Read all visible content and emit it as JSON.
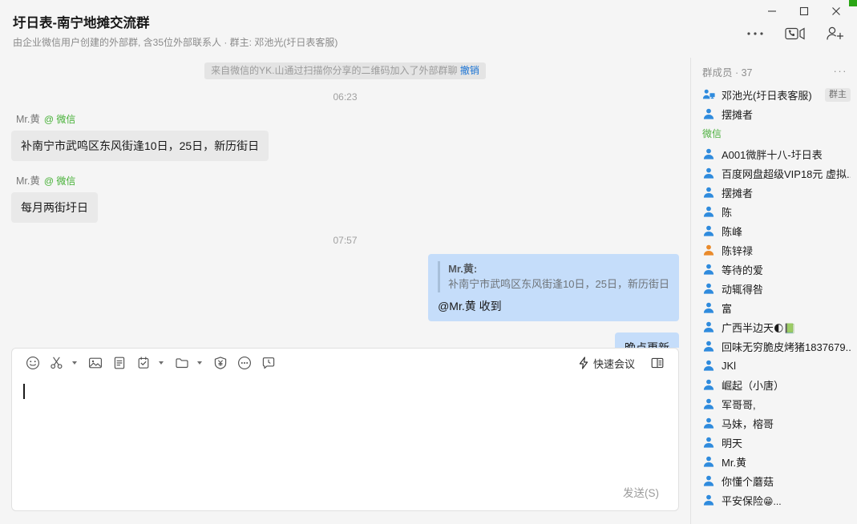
{
  "window": {
    "minimize_label": "Minimize",
    "maximize_label": "Maximize",
    "close_label": "Close"
  },
  "header": {
    "title": "圩日表-南宁地摊交流群",
    "subtitle": "由企业微信用户创建的外部群, 含35位外部联系人 · 群主: 邓池光(圩日表客服)",
    "actions": [
      {
        "name": "more-options-icon",
        "label": "更多"
      },
      {
        "name": "video-call-icon",
        "label": "视频通话"
      },
      {
        "name": "add-member-icon",
        "label": "添加成员"
      }
    ]
  },
  "chat": {
    "system_message": {
      "text": "来自微信的YK.山通过扫描你分享的二维码加入了外部群聊",
      "undo_label": "撤销"
    },
    "timestamps": {
      "first": "06:23",
      "second": "07:57"
    },
    "messages": [
      {
        "sender": "Mr.黄",
        "source_tag": "@ 微信",
        "text": "补南宁市武鸣区东风街逢10日，25日，新历街日",
        "side": "in"
      },
      {
        "sender": "Mr.黄",
        "source_tag": "@ 微信",
        "text": "每月两街圩日",
        "side": "in"
      },
      {
        "quote_name": "Mr.黄:",
        "quote_text": "补南宁市武鸣区东风街逢10日，25日，新历街日",
        "text": "@Mr.黄 收到",
        "side": "out"
      },
      {
        "text": "晚点更新",
        "side": "out"
      }
    ]
  },
  "composer": {
    "tools": [
      {
        "name": "emoji-icon",
        "label": "表情",
        "caret": false
      },
      {
        "name": "scissors-screenshot-icon",
        "label": "截图",
        "caret": true
      },
      {
        "name": "image-icon",
        "label": "图片",
        "caret": false
      },
      {
        "name": "document-icon",
        "label": "文档",
        "caret": false
      },
      {
        "name": "checklist-todo-icon",
        "label": "待办",
        "caret": true
      },
      {
        "name": "folder-icon",
        "label": "文件",
        "caret": true
      },
      {
        "name": "red-packet-icon",
        "label": "红包",
        "caret": false
      },
      {
        "name": "more-tools-icon",
        "label": "更多",
        "caret": false
      },
      {
        "name": "chat-history-icon",
        "label": "聊天记录",
        "caret": false
      }
    ],
    "quick_meeting_label": "快速会议",
    "panel_toggle_label": "侧边栏",
    "input_value": "",
    "input_placeholder": "",
    "send_label": "发送(S)"
  },
  "members_panel": {
    "title": "群成员 · 37",
    "more_label": "···",
    "owner_badge": "群主",
    "groups": [
      {
        "section": null,
        "items": [
          {
            "name": "邓池光(圩日表客服)",
            "avatar": "device",
            "badge": "群主"
          },
          {
            "name": "摆摊者",
            "avatar": "blue"
          }
        ]
      },
      {
        "section": "微信",
        "items": [
          {
            "name": "A001微胖十八-圩日表",
            "avatar": "blue"
          },
          {
            "name": "百度网盘超级VIP18元 虚拟...",
            "avatar": "blue"
          },
          {
            "name": "摆摊者",
            "avatar": "blue"
          },
          {
            "name": "陈",
            "avatar": "blue"
          },
          {
            "name": "陈峰",
            "avatar": "blue"
          },
          {
            "name": "陈锌禄",
            "avatar": "orange"
          },
          {
            "name": "等待的爱",
            "avatar": "blue"
          },
          {
            "name": "动辄得咎",
            "avatar": "blue"
          },
          {
            "name": "富",
            "avatar": "blue"
          },
          {
            "name": "广西半边天",
            "avatar": "blue",
            "emoji": "🌓📗"
          },
          {
            "name": "回味无穷脆皮烤猪1837679...",
            "avatar": "blue"
          },
          {
            "name": "JKl",
            "avatar": "blue"
          },
          {
            "name": "崛起（小唐）",
            "avatar": "blue"
          },
          {
            "name": "军哥哥,",
            "avatar": "blue"
          },
          {
            "name": "马妹，榕哥",
            "avatar": "blue"
          },
          {
            "name": "明天",
            "avatar": "blue"
          },
          {
            "name": "Mr.黄",
            "avatar": "blue"
          },
          {
            "name": "你懂个蘑菇",
            "avatar": "blue"
          },
          {
            "name": "平安保险",
            "avatar": "blue",
            "emoji": "😁",
            "suffix": "..."
          }
        ]
      }
    ]
  },
  "colors": {
    "accent_green": "#2aa515",
    "link_blue": "#1a73d4",
    "outgoing_bubble": "#c5ddfa",
    "incoming_bubble": "#e9e9e9",
    "avatar_blue": "#2f8bdd",
    "avatar_orange": "#e98a2b"
  }
}
